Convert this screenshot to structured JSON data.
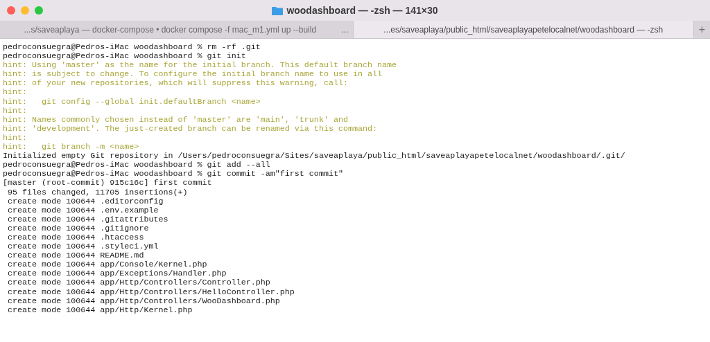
{
  "window": {
    "title": "woodashboard — -zsh — 141×30"
  },
  "tabs": [
    {
      "label": "...s/saveaplaya — docker-compose • docker compose -f mac_m1.yml up --build",
      "selected": false
    },
    {
      "label": "...es/saveaplaya/public_html/saveaplayapetelocalnet/woodashboard — -zsh",
      "selected": true
    }
  ],
  "tab_overflow": "...",
  "new_tab": "+",
  "lines": [
    {
      "kind": "prompt",
      "text": "pedroconsuegra@Pedros-iMac woodashboard % rm -rf .git"
    },
    {
      "kind": "prompt",
      "text": "pedroconsuegra@Pedros-iMac woodashboard % git init"
    },
    {
      "kind": "hint",
      "text": "hint: Using 'master' as the name for the initial branch. This default branch name"
    },
    {
      "kind": "hint",
      "text": "hint: is subject to change. To configure the initial branch name to use in all"
    },
    {
      "kind": "hint",
      "text": "hint: of your new repositories, which will suppress this warning, call:"
    },
    {
      "kind": "hint",
      "text": "hint:"
    },
    {
      "kind": "hint",
      "text": "hint:   git config --global init.defaultBranch <name>"
    },
    {
      "kind": "hint",
      "text": "hint:"
    },
    {
      "kind": "hint",
      "text": "hint: Names commonly chosen instead of 'master' are 'main', 'trunk' and"
    },
    {
      "kind": "hint",
      "text": "hint: 'development'. The just-created branch can be renamed via this command:"
    },
    {
      "kind": "hint",
      "text": "hint:"
    },
    {
      "kind": "hint",
      "text": "hint:   git branch -m <name>"
    },
    {
      "kind": "output",
      "text": "Initialized empty Git repository in /Users/pedroconsuegra/Sites/saveaplaya/public_html/saveaplayapetelocalnet/woodashboard/.git/"
    },
    {
      "kind": "prompt",
      "text": "pedroconsuegra@Pedros-iMac woodashboard % git add --all"
    },
    {
      "kind": "prompt",
      "text": "pedroconsuegra@Pedros-iMac woodashboard % git commit -am\"first commit\""
    },
    {
      "kind": "output",
      "text": "[master (root-commit) 915c16c] first commit"
    },
    {
      "kind": "output",
      "text": " 95 files changed, 11705 insertions(+)"
    },
    {
      "kind": "output",
      "text": " create mode 100644 .editorconfig"
    },
    {
      "kind": "output",
      "text": " create mode 100644 .env.example"
    },
    {
      "kind": "output",
      "text": " create mode 100644 .gitattributes"
    },
    {
      "kind": "output",
      "text": " create mode 100644 .gitignore"
    },
    {
      "kind": "output",
      "text": " create mode 100644 .htaccess"
    },
    {
      "kind": "output",
      "text": " create mode 100644 .styleci.yml"
    },
    {
      "kind": "output",
      "text": " create mode 100644 README.md"
    },
    {
      "kind": "output",
      "text": " create mode 100644 app/Console/Kernel.php"
    },
    {
      "kind": "output",
      "text": " create mode 100644 app/Exceptions/Handler.php"
    },
    {
      "kind": "output",
      "text": " create mode 100644 app/Http/Controllers/Controller.php"
    },
    {
      "kind": "output",
      "text": " create mode 100644 app/Http/Controllers/HelloController.php"
    },
    {
      "kind": "output",
      "text": " create mode 100644 app/Http/Controllers/WooDashboard.php"
    },
    {
      "kind": "output",
      "text": " create mode 100644 app/Http/Kernel.php"
    }
  ]
}
